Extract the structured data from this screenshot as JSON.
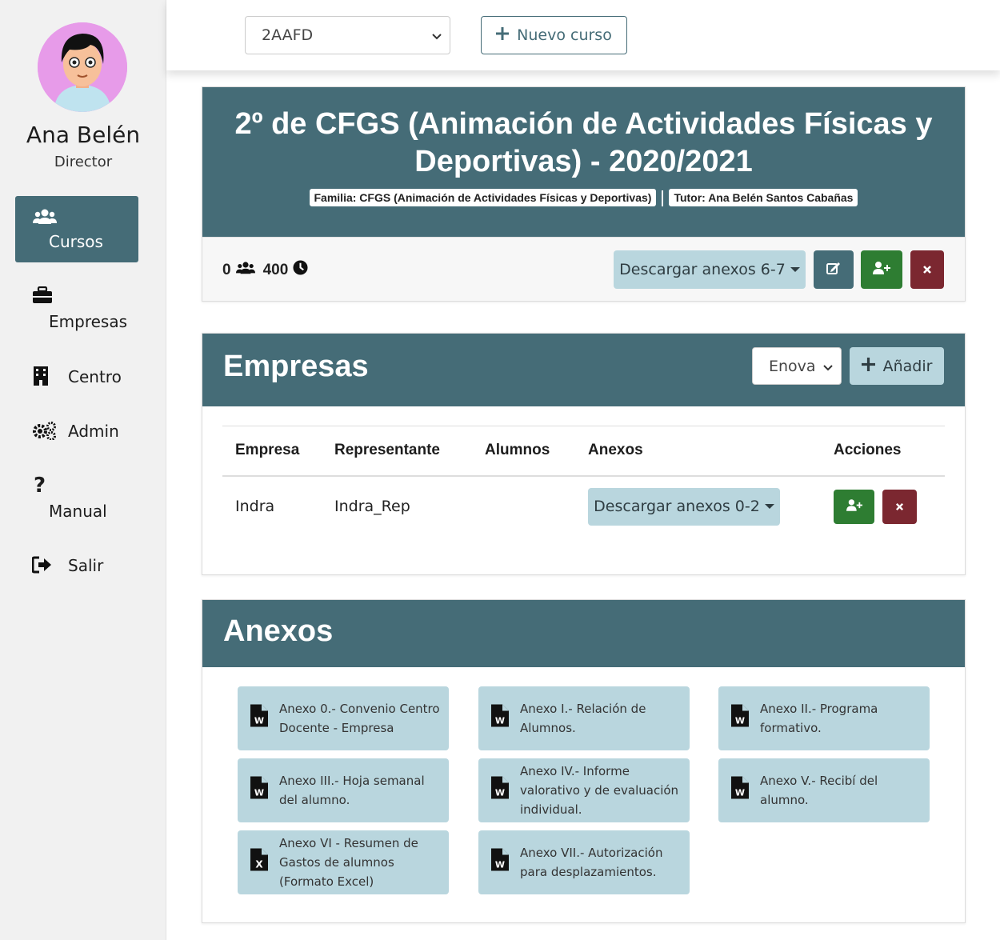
{
  "user": {
    "name": "Ana Belén",
    "role": "Director"
  },
  "sidebar": {
    "items": [
      {
        "label": "Cursos",
        "icon": "users-icon",
        "active": true
      },
      {
        "label": "Empresas",
        "icon": "briefcase-icon"
      },
      {
        "label": "Centro",
        "icon": "building-icon"
      },
      {
        "label": "Admin",
        "icon": "cogs-icon"
      },
      {
        "label": "Manual",
        "icon": "question-icon"
      },
      {
        "label": "Salir",
        "icon": "sign-out-icon"
      }
    ]
  },
  "topbar": {
    "course_select": "2AAFD",
    "new_course_label": "Nuevo curso"
  },
  "course": {
    "title": "2º de CFGS (Animación de Actividades Físicas y Deportivas) - 2020/2021",
    "familia_badge": "Familia: CFGS (Animación de Actividades Físicas y Deportivas)",
    "tutor_badge": "Tutor: Ana Belén Santos Cabañas",
    "students_count": "0",
    "hours": "400",
    "download_label": "Descargar anexos 6-7"
  },
  "empresas": {
    "title": "Empresas",
    "select_value": "Enova",
    "add_label": "Añadir",
    "columns": [
      "Empresa",
      "Representante",
      "Alumnos",
      "Anexos",
      "Acciones"
    ],
    "rows": [
      {
        "empresa": "Indra",
        "representante": "Indra_Rep",
        "alumnos": "",
        "download_label": "Descargar anexos 0-2"
      }
    ]
  },
  "anexos": {
    "title": "Anexos",
    "items": [
      {
        "label": "Anexo 0.- Convenio Centro Docente - Empresa",
        "icon": "word-file-icon"
      },
      {
        "label": "Anexo I.- Relación de Alumnos.",
        "icon": "word-file-icon"
      },
      {
        "label": "Anexo II.- Programa formativo.",
        "icon": "word-file-icon"
      },
      {
        "label": "Anexo III.- Hoja semanal del alumno.",
        "icon": "word-file-icon"
      },
      {
        "label": "Anexo IV.- Informe valorativo y de evaluación individual.",
        "icon": "word-file-icon"
      },
      {
        "label": "Anexo V.- Recibí del alumno.",
        "icon": "word-file-icon"
      },
      {
        "label": "Anexo VI - Resumen de Gastos de alumnos (Formato Excel)",
        "icon": "excel-file-icon"
      },
      {
        "label": "Anexo VII.- Autorización para desplazamientos.",
        "icon": "word-file-icon"
      }
    ]
  },
  "colors": {
    "primary": "#456c77",
    "light": "#b9d6de",
    "success": "#2e7d32",
    "danger": "#7b2730"
  }
}
